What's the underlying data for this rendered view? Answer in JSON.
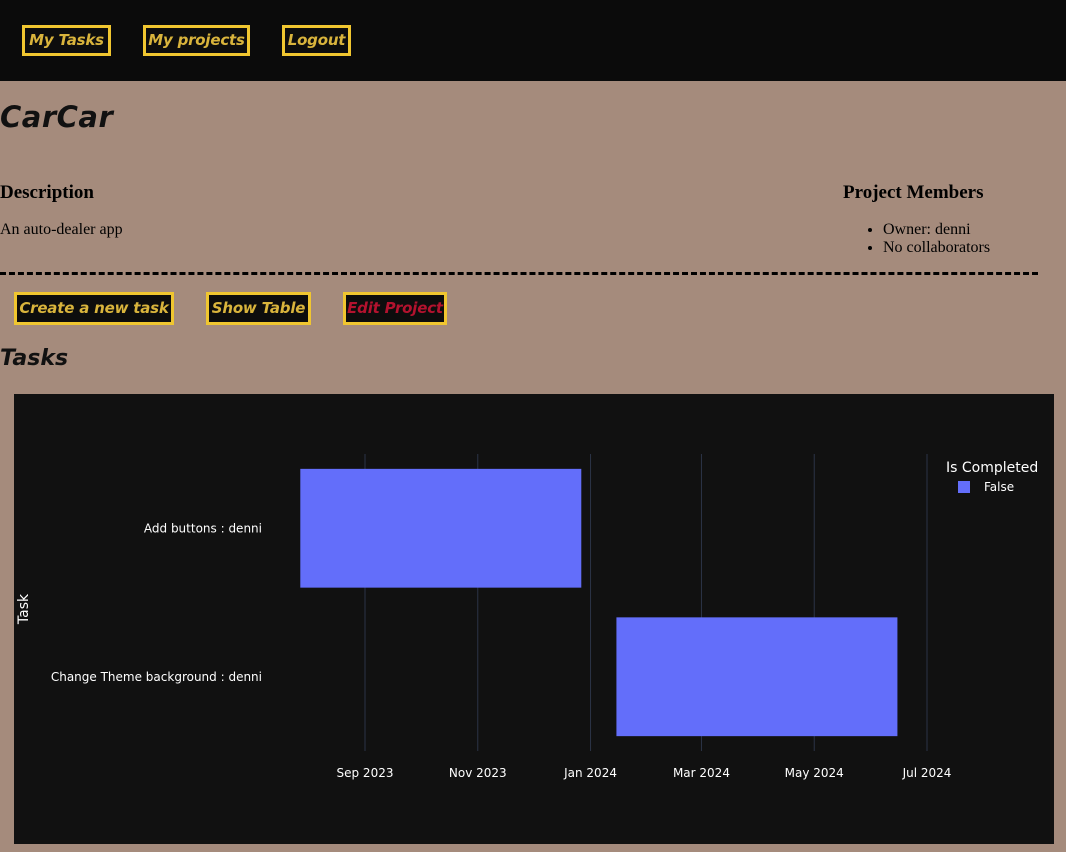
{
  "nav": {
    "my_tasks": "My Tasks",
    "my_projects": "My projects",
    "logout": "Logout"
  },
  "project": {
    "name": "CarCar",
    "description_heading": "Description",
    "description": "An auto-dealer app",
    "members_heading": "Project Members",
    "members": [
      "Owner: denni",
      "No collaborators"
    ]
  },
  "actions": {
    "create_task": "Create a new task",
    "show_table": "Show Table",
    "edit_project": "Edit Project"
  },
  "tasks_heading": "Tasks",
  "colors": {
    "accent_border": "#f0c630",
    "button_text": "#d9b43c",
    "edit_text": "#b3122e",
    "bar": "#636efa",
    "chart_bg": "#111111"
  },
  "chart_data": {
    "type": "bar",
    "orientation": "horizontal-gantt",
    "ylabel": "Task",
    "xlabel": "",
    "x_ticks": [
      "Sep 2023",
      "Nov 2023",
      "Jan 2024",
      "Mar 2024",
      "May 2024",
      "Jul 2024"
    ],
    "x_tick_dates": [
      "2023-09-01",
      "2023-11-01",
      "2024-01-01",
      "2024-03-01",
      "2024-05-01",
      "2024-07-01"
    ],
    "legend_title": "Is Completed",
    "legend_placement": "top-right",
    "grid": true,
    "series": [
      {
        "name": "False",
        "color": "#636efa",
        "tasks": [
          {
            "task": "Add buttons : denni",
            "start": "2023-07-28",
            "end": "2023-12-27"
          },
          {
            "task": "Change Theme background : denni",
            "start": "2024-01-15",
            "end": "2024-06-15"
          }
        ]
      }
    ]
  }
}
